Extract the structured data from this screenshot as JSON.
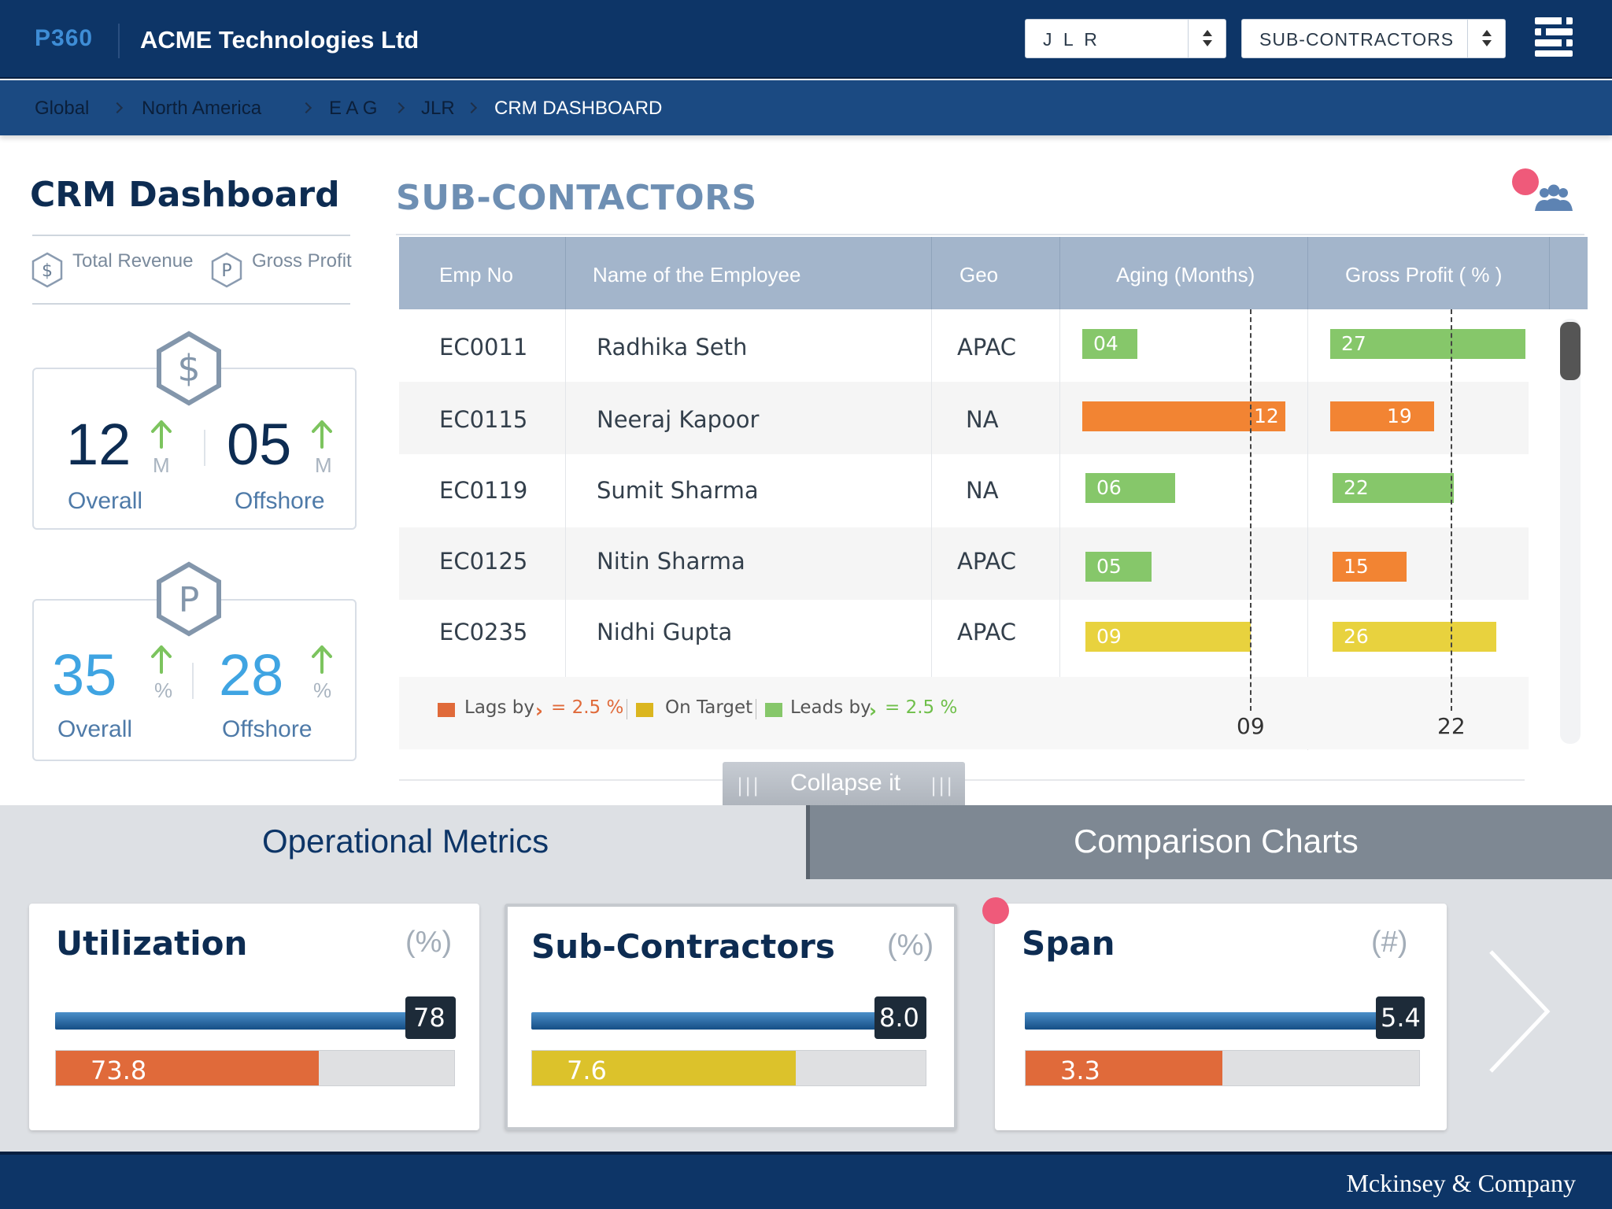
{
  "header": {
    "logo": "P360",
    "company": "ACME Technologies Ltd",
    "client_select": "J L R",
    "view_select": "SUB-CONTRACTORS"
  },
  "breadcrumb": [
    "Global",
    "North America",
    "E A G",
    "JLR",
    "CRM DASHBOARD"
  ],
  "left": {
    "title": "CRM Dashboard",
    "legend": {
      "revenue": "Total Revenue",
      "profit": "Gross Profit",
      "revenue_icon": "$",
      "profit_icon": "P"
    },
    "revenue_card": {
      "icon": "$",
      "overall": "12",
      "overall_unit": "M",
      "overall_label": "Overall",
      "offshore": "05",
      "offshore_unit": "M",
      "offshore_label": "Offshore"
    },
    "profit_card": {
      "icon": "P",
      "overall": "35",
      "overall_unit": "%",
      "overall_label": "Overall",
      "offshore": "28",
      "offshore_unit": "%",
      "offshore_label": "Offshore"
    }
  },
  "table": {
    "title": "SUB-CONTACTORS",
    "columns": [
      "Emp No",
      "Name of the Employee",
      "Geo",
      "Aging (Months)",
      "Gross Profit ( % )"
    ],
    "rows": [
      {
        "emp": "EC0011",
        "name": "Radhika Seth",
        "geo": "APAC",
        "aging": "04",
        "aging_status": "green",
        "profit": "27",
        "profit_status": "green"
      },
      {
        "emp": "EC0115",
        "name": "Neeraj Kapoor",
        "geo": "NA",
        "aging": "12",
        "aging_status": "orange",
        "profit": "19",
        "profit_status": "orange"
      },
      {
        "emp": "EC0119",
        "name": "Sumit Sharma",
        "geo": "NA",
        "aging": "06",
        "aging_status": "green",
        "profit": "22",
        "profit_status": "green"
      },
      {
        "emp": "EC0125",
        "name": "Nitin Sharma",
        "geo": "APAC",
        "aging": "05",
        "aging_status": "green",
        "profit": "15",
        "profit_status": "orange"
      },
      {
        "emp": "EC0235",
        "name": "Nidhi Gupta",
        "geo": "APAC",
        "aging": "09",
        "aging_status": "yellow",
        "profit": "26",
        "profit_status": "yellow"
      }
    ],
    "aging_target": "09",
    "profit_target": "22",
    "legend": {
      "lags": "Lags by",
      "lags_value": "= 2.5 %",
      "on_target": "On Target",
      "leads": "Leads by",
      "leads_value": "= 2.5 %"
    },
    "collapse_label": "Collapse it",
    "collapse_grip": "|||"
  },
  "tabs": {
    "ops": "Operational Metrics",
    "compare": "Comparison Charts"
  },
  "metrics": [
    {
      "title": "Utilization",
      "unit": "(%)",
      "target": "78",
      "actual": "73.8",
      "actual_fraction": 0.66,
      "actual_color": "#e06a3a"
    },
    {
      "title": "Sub-Contractors",
      "unit": "(%)",
      "target": "8.0",
      "actual": "7.6",
      "actual_fraction": 0.67,
      "actual_color": "#dcc22b"
    },
    {
      "title": "Span",
      "unit": "(#)",
      "target": "5.4",
      "actual": "3.3",
      "actual_fraction": 0.5,
      "actual_color": "#e06a3a"
    }
  ],
  "footer": {
    "brand": "Mckinsey & Company"
  },
  "colors": {
    "navy": "#0d3567",
    "green": "#86c76a",
    "orange": "#f28433",
    "yellow": "#e8d23e",
    "lag": "#e06a3a",
    "target": "#dbb61f",
    "lead": "#86c76a"
  }
}
